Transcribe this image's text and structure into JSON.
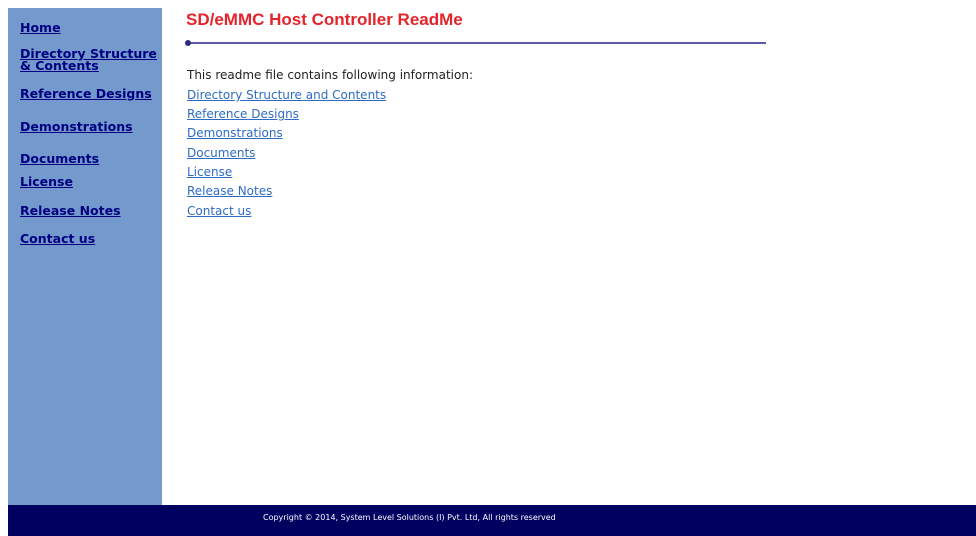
{
  "sidebar": {
    "items": [
      {
        "label": "Home"
      },
      {
        "label": "Directory Structure & Contents"
      },
      {
        "label": "Reference Designs"
      },
      {
        "label": "Demonstrations"
      },
      {
        "label": "Documents"
      },
      {
        "label": "License"
      },
      {
        "label": "Release Notes"
      },
      {
        "label": "Contact us"
      }
    ]
  },
  "main": {
    "title": "SD/eMMC Host Controller ReadMe",
    "intro": "This readme file contains following information:",
    "links": [
      {
        "label": "Directory Structure and Contents"
      },
      {
        "label": "Reference Designs"
      },
      {
        "label": "Demonstrations"
      },
      {
        "label": "Documents"
      },
      {
        "label": "License"
      },
      {
        "label": "Release Notes"
      },
      {
        "label": "Contact us"
      }
    ]
  },
  "footer": {
    "copyright": "Copyright © 2014, System Level Solutions (I) Pvt. Ltd, All rights reserved"
  },
  "colors": {
    "sidebar_bg": "#7399cd",
    "nav_link": "#000080",
    "title": "#e3242b",
    "content_link": "#2f6bc5",
    "footer_bg": "#000060"
  }
}
